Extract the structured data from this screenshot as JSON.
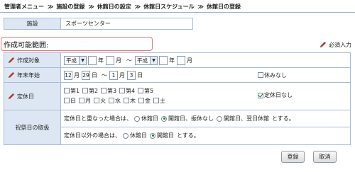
{
  "breadcrumb": {
    "items": [
      "管理者メニュー",
      "施設の登録",
      "休館日の設定",
      "休館日スケジュール",
      "休館日の登録"
    ],
    "separator": "≫"
  },
  "facility": {
    "label": "施設",
    "value": "スポーツセンター"
  },
  "range_title": "作成可能範囲:",
  "required_note": "必須入力",
  "period": {
    "label": "作成対象",
    "from_era": "平成",
    "from_year": "",
    "year_unit": "年",
    "from_month": "",
    "month_unit": "月",
    "tilde": "～",
    "to_era": "平成",
    "to_year": "",
    "to_month": ""
  },
  "new_year": {
    "label": "年末年始",
    "from_month": "12",
    "from_day": "29",
    "to_month": "1",
    "to_day": "3",
    "month_unit": "月",
    "day_unit": "日",
    "tilde": "～",
    "none_label": "休みなし",
    "none_checked": false
  },
  "closed_day": {
    "label": "定休日",
    "weeks": [
      "第1",
      "第2",
      "第3",
      "第4",
      "第5"
    ],
    "weekdays": [
      "日",
      "月",
      "火",
      "水",
      "木",
      "金",
      "土"
    ],
    "none_label": "定休日なし",
    "none_checked": true
  },
  "holiday": {
    "label": "祝祭日の取扱",
    "line1_prefix": "定休日と重なった場合は、",
    "line1_opt1": "休館日",
    "line1_opt2": "開館日、振休なし",
    "line1_opt3": "開館日、翌日休館",
    "line1_suffix": "とする。",
    "line1_selected": 2,
    "line2_prefix": "定休日以外の場合は、",
    "line2_opt1": "休館日",
    "line2_opt2": "開館日",
    "line2_suffix": "とする。",
    "line2_selected": 2
  },
  "buttons": {
    "register": "登録",
    "cancel": "取消"
  },
  "colors": {
    "header_cell": "#dde7f3",
    "border": "#a8bcd4",
    "range_border": "#e07a7a",
    "check": "#1b7a2a",
    "pencil": "#c0392b"
  }
}
